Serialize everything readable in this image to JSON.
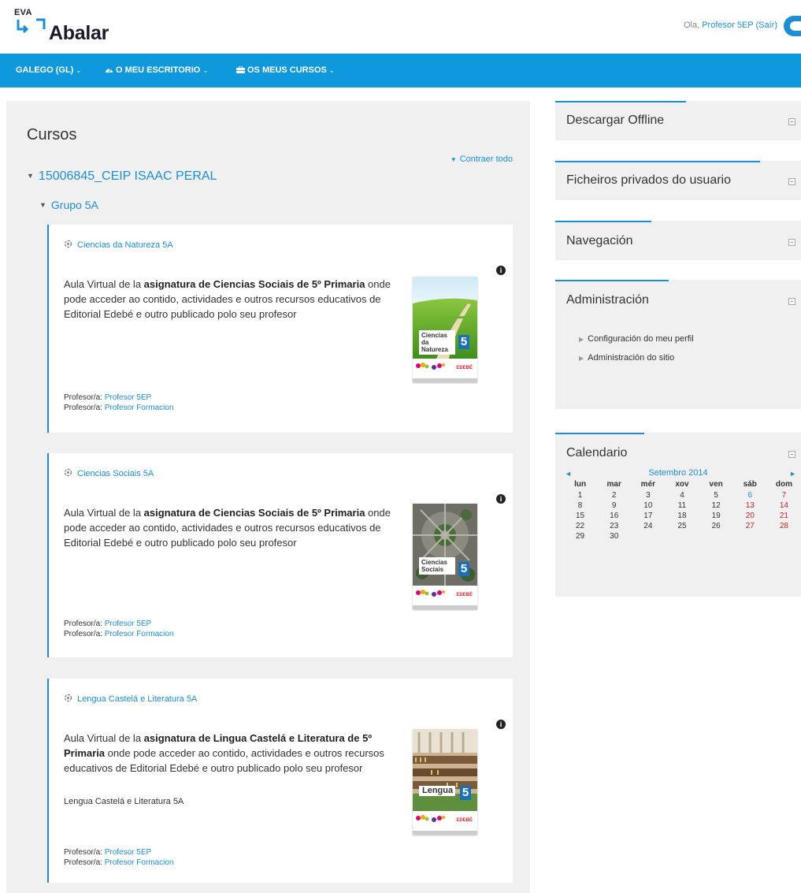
{
  "header": {
    "logo_small": "EVA",
    "logo_name": "Abalar",
    "greeting": "Ola, ",
    "user_name": "Profesor 5EP",
    "logout": "(Saír)"
  },
  "nav": {
    "language": "GALEGO (GL)",
    "desk": "O MEU ESCRITORIO",
    "courses": "OS MEUS CURSOS"
  },
  "main": {
    "title": "Cursos",
    "collapse_all": "Contraer todo",
    "school": "15006845_CEIP ISAAC PERAL",
    "group": "Grupo 5A",
    "teacher_label": "Profesor/a:",
    "courses": [
      {
        "name": "Ciencias da Natureza 5A",
        "summary_pre": "Aula Virtual de la ",
        "summary_bold": "asignatura de Ciencias Sociais de 5º Primaria",
        "summary_post": " onde pode acceder ao contido, actividades e outros recursos educativos de Editorial Edebé e outro publicado polo seu profesor",
        "extra": "",
        "cover_title": "Ciencias da Natureza",
        "cover_number": "5",
        "publisher": "EDEBÉ",
        "teachers": [
          "Profesor 5EP",
          "Profesor Formacion"
        ]
      },
      {
        "name": "Ciencias Sociais 5A",
        "summary_pre": "Aula Virtual de la ",
        "summary_bold": "asignatura de Ciencias Sociais de 5º Primaria",
        "summary_post": " onde pode acceder ao contido, actividades e outros recursos educativos de Editorial Edebé e outro publicado polo seu profesor",
        "extra": "",
        "cover_title": "Ciencias Sociais",
        "cover_number": "5",
        "publisher": "EDEBÉ",
        "teachers": [
          "Profesor 5EP",
          "Profesor Formacion"
        ]
      },
      {
        "name": "Lengua Castelá e Literatura 5A",
        "summary_pre": "Aula Virtual de la ",
        "summary_bold": "asignatura de Lingua Castelá e Literatura de 5º Primaria",
        "summary_post": " onde pode acceder ao contido, actividades e outros recursos educativos de Editorial Edebé e outro publicado polo seu profesor",
        "extra": "Lengua Castelá e Literatura 5A",
        "cover_title": "Lengua",
        "cover_number": "5",
        "publisher": "EDEBÉ",
        "teachers": [
          "Profesor 5EP",
          "Profesor Formacion"
        ]
      }
    ]
  },
  "blocks": {
    "offline": "Descargar Offline",
    "private_files": "Ficheiros privados do usuario",
    "navigation": "Navegación",
    "administration": "Administración",
    "admin_items": [
      "Configuración do meu perfil",
      "Administración do sitio"
    ],
    "calendar": "Calendario"
  },
  "calendar": {
    "prev": "◄",
    "next": "►",
    "month": "Setembro 2014",
    "weekdays": [
      "lun",
      "mar",
      "mér",
      "xov",
      "ven",
      "sáb",
      "dom"
    ],
    "weeks": [
      [
        "1",
        "2",
        "3",
        "4",
        "5",
        "6",
        "7"
      ],
      [
        "8",
        "9",
        "10",
        "11",
        "12",
        "13",
        "14"
      ],
      [
        "15",
        "16",
        "17",
        "18",
        "19",
        "20",
        "21"
      ],
      [
        "22",
        "23",
        "24",
        "25",
        "26",
        "27",
        "28"
      ],
      [
        "29",
        "30",
        "",
        "",
        "",
        "",
        ""
      ]
    ],
    "today": "6"
  },
  "colors": {
    "accent": "#0e99dd",
    "link": "#1a8fd8",
    "weekend": "#cc2222"
  }
}
